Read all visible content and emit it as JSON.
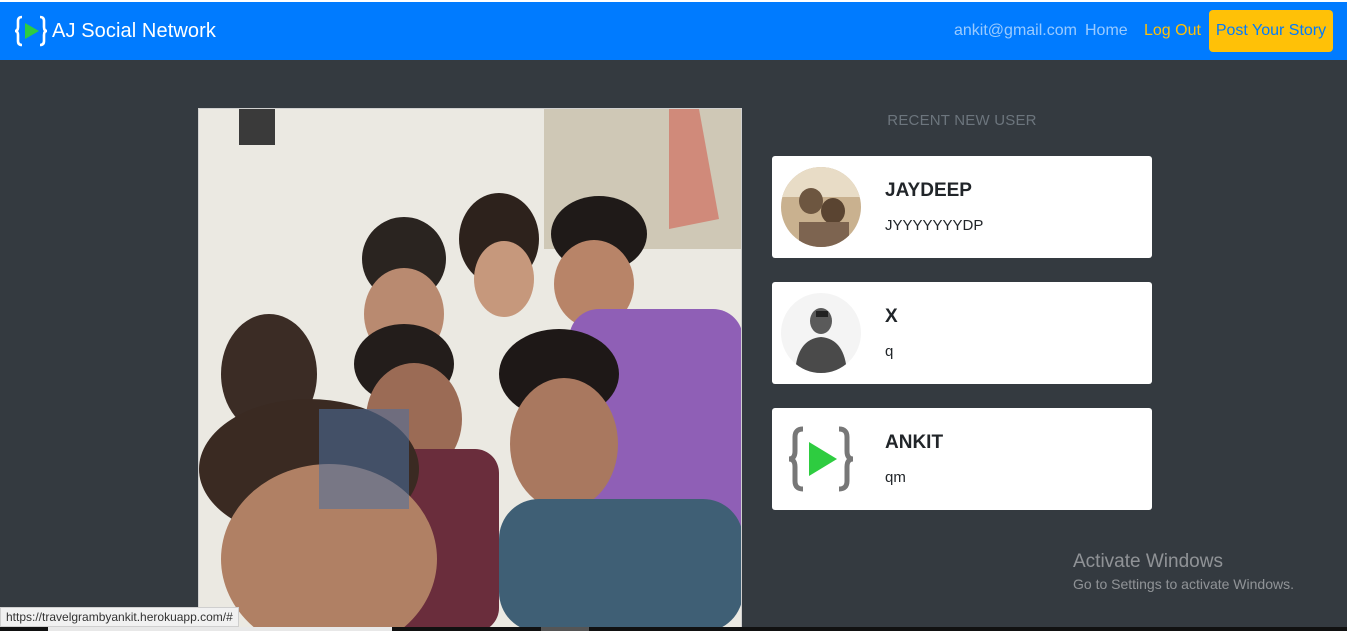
{
  "navbar": {
    "brand": "AJ Social Network",
    "email": "ankit@gmail.com",
    "home": "Home",
    "logout": "Log Out",
    "post_story": "Post Your Story"
  },
  "sidebar": {
    "title": "RECENT NEW USER",
    "users": [
      {
        "name": "JAYDEEP",
        "desc": "JYYYYYYYDP",
        "avatar": "sepia-photo"
      },
      {
        "name": "X",
        "desc": "q",
        "avatar": "bw-portrait-photo"
      },
      {
        "name": "ANKIT",
        "desc": "qm",
        "avatar": "brand-logo-icon"
      }
    ]
  },
  "watermark": {
    "title": "Activate Windows",
    "subtitle": "Go to Settings to activate Windows."
  },
  "status_bar": {
    "url": "https://travelgrambyankit.herokuapp.com/#"
  },
  "colors": {
    "navbar": "#007bff",
    "background": "#343a40",
    "accent": "#ffc107",
    "logo_play": "#2ecc40"
  }
}
